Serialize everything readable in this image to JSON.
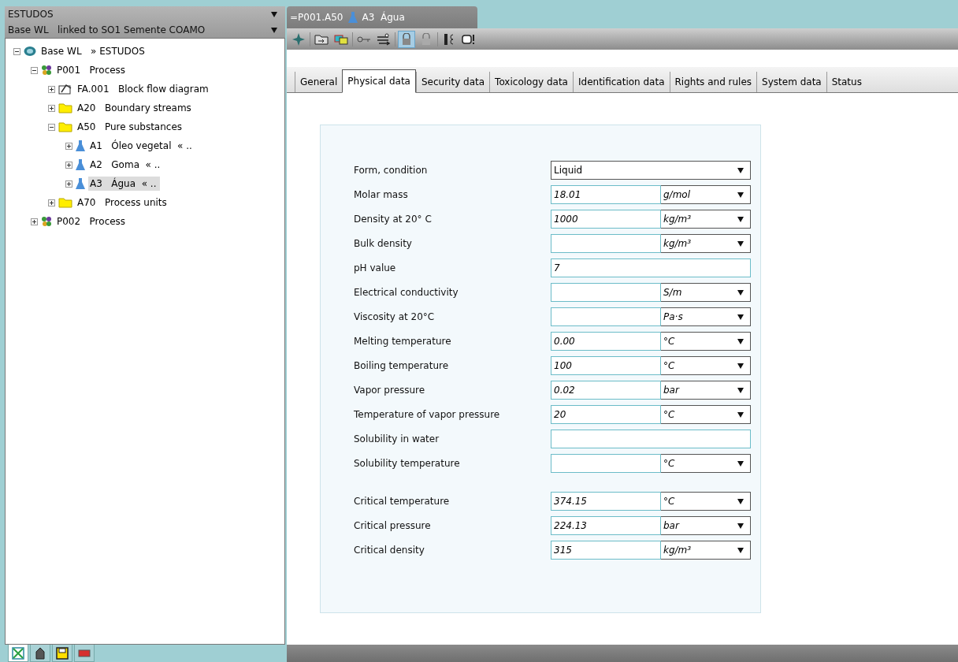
{
  "left_panel": {
    "dropdowns": [
      {
        "label": "ESTUDOS"
      },
      {
        "label": "Base WL   linked to SO1 Semente COAMO"
      }
    ],
    "tree": [
      {
        "kind": "globe",
        "code": "Base WL",
        "name": "» ESTUDOS",
        "expanded": true,
        "selected": false,
        "children": [
          {
            "kind": "process",
            "code": "P001",
            "name": "Process",
            "expanded": true,
            "selected": false,
            "children": [
              {
                "kind": "diagram",
                "code": "FA.001",
                "name": "Block flow diagram",
                "expanded": false,
                "selected": false
              },
              {
                "kind": "folder",
                "code": "A20",
                "name": "Boundary streams",
                "expanded": false,
                "selected": false
              },
              {
                "kind": "folder",
                "code": "A50",
                "name": "Pure substances",
                "expanded": true,
                "selected": false,
                "children": [
                  {
                    "kind": "flask",
                    "code": "A1",
                    "name": "Óleo vegetal  « ..",
                    "expanded": false,
                    "selected": false
                  },
                  {
                    "kind": "flask",
                    "code": "A2",
                    "name": "Goma  « ..",
                    "expanded": false,
                    "selected": false
                  },
                  {
                    "kind": "flask",
                    "code": "A3",
                    "name": "Água  « ..",
                    "expanded": false,
                    "selected": true
                  }
                ]
              },
              {
                "kind": "folder",
                "code": "A70",
                "name": "Process units",
                "expanded": false,
                "selected": false
              }
            ]
          },
          {
            "kind": "process",
            "code": "P002",
            "name": "Process",
            "expanded": false,
            "selected": false
          }
        ]
      }
    ],
    "bottom_tabs": [
      {
        "selected": true
      },
      {
        "selected": false
      },
      {
        "selected": false
      },
      {
        "selected": false
      }
    ]
  },
  "document_tab": {
    "path": "=P001.A50",
    "code": "A3",
    "name": "Água"
  },
  "toolbar": [
    {
      "active": false
    },
    {
      "active": false
    },
    {
      "active": false
    },
    {
      "active": false
    },
    {
      "active": false
    },
    {
      "active": true
    },
    {
      "active": false
    },
    {
      "active": false
    },
    {
      "active": false
    }
  ],
  "tabs": [
    {
      "label": "General",
      "selected": false
    },
    {
      "label": "Physical data",
      "selected": true
    },
    {
      "label": "Security data",
      "selected": false
    },
    {
      "label": "Toxicology data",
      "selected": false
    },
    {
      "label": "Identification data",
      "selected": false
    },
    {
      "label": "Rights and rules",
      "selected": false
    },
    {
      "label": "System data",
      "selected": false
    },
    {
      "label": "Status",
      "selected": false
    }
  ],
  "form": {
    "groups": [
      [
        {
          "label": "Form, condition",
          "kind": "select",
          "value": "Liquid"
        },
        {
          "label": "Molar mass",
          "kind": "value_unit",
          "value": "18.01",
          "unit": "g/mol"
        },
        {
          "label": "Density at 20° C",
          "kind": "value_unit",
          "value": "1000",
          "unit": "kg/m³"
        },
        {
          "label": "Bulk density",
          "kind": "value_unit",
          "unit": "kg/m³"
        },
        {
          "label": "pH value",
          "kind": "text",
          "value": "7"
        },
        {
          "label": "Electrical conductivity",
          "kind": "value_unit",
          "unit": "S/m"
        },
        {
          "label": "Viscosity at 20°C",
          "kind": "value_unit",
          "unit": "Pa·s"
        },
        {
          "label": "Melting temperature",
          "kind": "value_unit",
          "value": "0.00",
          "unit": "°C"
        },
        {
          "label": "Boiling temperature",
          "kind": "value_unit",
          "value": "100",
          "unit": "°C"
        },
        {
          "label": "Vapor pressure",
          "kind": "value_unit",
          "value": "0.02",
          "unit": "bar"
        },
        {
          "label": "Temperature of vapor pressure",
          "kind": "value_unit",
          "value": "20",
          "unit": "°C"
        },
        {
          "label": "Solubility in water",
          "kind": "text"
        },
        {
          "label": "Solubility temperature",
          "kind": "value_unit",
          "unit": "°C"
        }
      ],
      [
        {
          "label": "Critical temperature",
          "kind": "value_unit",
          "value": "374.15",
          "unit": "°C"
        },
        {
          "label": "Critical pressure",
          "kind": "value_unit",
          "value": "224.13",
          "unit": "bar"
        },
        {
          "label": "Critical density",
          "kind": "value_unit",
          "value": "315",
          "unit": "kg/m³"
        }
      ]
    ]
  }
}
